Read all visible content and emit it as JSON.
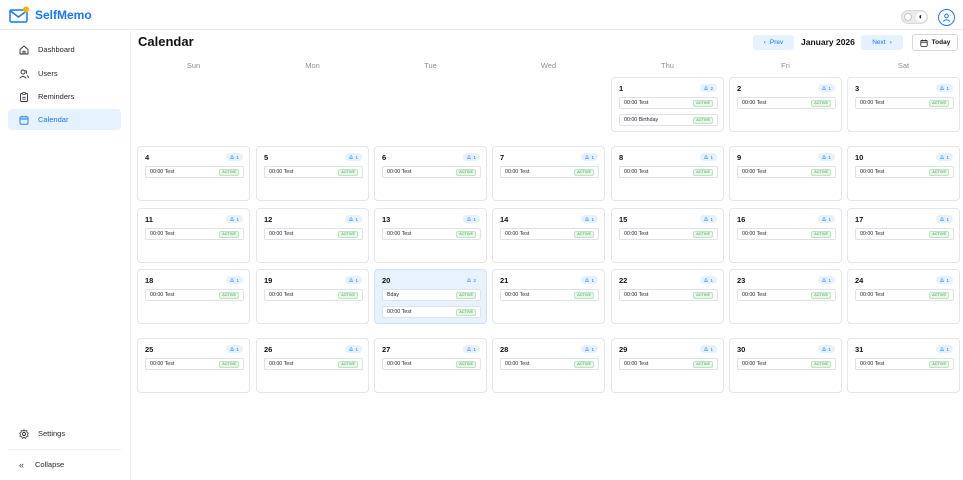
{
  "app": {
    "name": "SelfMemo",
    "theme_toggle_icon": "half-moon-icon",
    "avatar_icon": "user-circle-icon",
    "accent": "#1677ff"
  },
  "sidebar": {
    "items": [
      {
        "label": "Dashboard",
        "icon": "home-icon"
      },
      {
        "label": "Users",
        "icon": "users-icon"
      },
      {
        "label": "Reminders",
        "icon": "clipboard-icon"
      },
      {
        "label": "Calendar",
        "icon": "calendar-icon",
        "active": true
      }
    ],
    "settings_label": "Settings",
    "collapse_label": "Collapse",
    "collapse_glyph": "«"
  },
  "header": {
    "title": "Calendar",
    "prev_label": "Prev",
    "next_label": "Next",
    "month": "January 2026",
    "today_label": "Today"
  },
  "weekdays": [
    "Sun",
    "Mon",
    "Tue",
    "Wed",
    "Thu",
    "Fri",
    "Sat"
  ],
  "days": [
    {
      "day": "1",
      "count": "2",
      "events": [
        {
          "title": "00:00 Test",
          "status": "ACTIVE"
        },
        {
          "title": "00:00 Birthday",
          "status": "ACTIVE"
        }
      ]
    },
    {
      "day": "2",
      "count": "1",
      "events": [
        {
          "title": "00:00 Test",
          "status": "ACTIVE"
        }
      ]
    },
    {
      "day": "3",
      "count": "1",
      "events": [
        {
          "title": "00:00 Test",
          "status": "ACTIVE"
        }
      ]
    },
    {
      "day": "4",
      "count": "1",
      "events": [
        {
          "title": "00:00 Test",
          "status": "ACTIVE"
        }
      ]
    },
    {
      "day": "5",
      "count": "1",
      "events": [
        {
          "title": "00:00 Test",
          "status": "ACTIVE"
        }
      ]
    },
    {
      "day": "6",
      "count": "1",
      "events": [
        {
          "title": "00:00 Test",
          "status": "ACTIVE"
        }
      ]
    },
    {
      "day": "7",
      "count": "1",
      "events": [
        {
          "title": "00:00 Test",
          "status": "ACTIVE"
        }
      ]
    },
    {
      "day": "8",
      "count": "1",
      "events": [
        {
          "title": "00:00 Test",
          "status": "ACTIVE"
        }
      ]
    },
    {
      "day": "9",
      "count": "1",
      "events": [
        {
          "title": "00:00 Test",
          "status": "ACTIVE"
        }
      ]
    },
    {
      "day": "10",
      "count": "1",
      "events": [
        {
          "title": "00:00 Test",
          "status": "ACTIVE"
        }
      ]
    },
    {
      "day": "11",
      "count": "1",
      "events": [
        {
          "title": "00:00 Test",
          "status": "ACTIVE"
        }
      ]
    },
    {
      "day": "12",
      "count": "1",
      "events": [
        {
          "title": "00:00 Test",
          "status": "ACTIVE"
        }
      ]
    },
    {
      "day": "13",
      "count": "1",
      "events": [
        {
          "title": "00:00 Test",
          "status": "ACTIVE"
        }
      ]
    },
    {
      "day": "14",
      "count": "1",
      "events": [
        {
          "title": "00:00 Test",
          "status": "ACTIVE"
        }
      ]
    },
    {
      "day": "15",
      "count": "1",
      "events": [
        {
          "title": "00:00 Test",
          "status": "ACTIVE"
        }
      ]
    },
    {
      "day": "16",
      "count": "1",
      "events": [
        {
          "title": "00:00 Test",
          "status": "ACTIVE"
        }
      ]
    },
    {
      "day": "17",
      "count": "1",
      "events": [
        {
          "title": "00:00 Test",
          "status": "ACTIVE"
        }
      ]
    },
    {
      "day": "18",
      "count": "1",
      "events": [
        {
          "title": "00:00 Test",
          "status": "ACTIVE"
        }
      ]
    },
    {
      "day": "19",
      "count": "1",
      "events": [
        {
          "title": "00:00 Test",
          "status": "ACTIVE"
        }
      ]
    },
    {
      "day": "20",
      "count": "2",
      "today": true,
      "events": [
        {
          "title": "Bday",
          "status": "ACTIVE"
        },
        {
          "title": "00:00 Test",
          "status": "ACTIVE"
        }
      ]
    },
    {
      "day": "21",
      "count": "1",
      "events": [
        {
          "title": "00:00 Test",
          "status": "ACTIVE"
        }
      ]
    },
    {
      "day": "22",
      "count": "1",
      "events": [
        {
          "title": "00:00 Test",
          "status": "ACTIVE"
        }
      ]
    },
    {
      "day": "23",
      "count": "1",
      "events": [
        {
          "title": "00:00 Test",
          "status": "ACTIVE"
        }
      ]
    },
    {
      "day": "24",
      "count": "1",
      "events": [
        {
          "title": "00:00 Test",
          "status": "ACTIVE"
        }
      ]
    },
    {
      "day": "25",
      "count": "1",
      "events": [
        {
          "title": "00:00 Test",
          "status": "ACTIVE"
        }
      ]
    },
    {
      "day": "26",
      "count": "1",
      "events": [
        {
          "title": "00:00 Test",
          "status": "ACTIVE"
        }
      ]
    },
    {
      "day": "27",
      "count": "1",
      "events": [
        {
          "title": "00:00 Test",
          "status": "ACTIVE"
        }
      ]
    },
    {
      "day": "28",
      "count": "1",
      "events": [
        {
          "title": "00:00 Test",
          "status": "ACTIVE"
        }
      ]
    },
    {
      "day": "29",
      "count": "1",
      "events": [
        {
          "title": "00:00 Test",
          "status": "ACTIVE"
        }
      ]
    },
    {
      "day": "30",
      "count": "1",
      "events": [
        {
          "title": "00:00 Test",
          "status": "ACTIVE"
        }
      ]
    },
    {
      "day": "31",
      "count": "1",
      "events": [
        {
          "title": "00:00 Test",
          "status": "ACTIVE"
        }
      ]
    }
  ],
  "first_weekday_index": 4,
  "colors": {
    "accent": "#1677ff",
    "accent_bg": "#e6f2ff",
    "today_bg": "#e8f2fd",
    "status_green": "#3a9e4a"
  }
}
